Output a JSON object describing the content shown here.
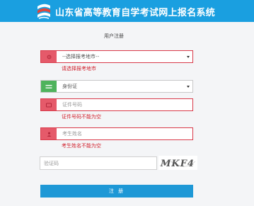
{
  "header": {
    "site_title": "山东省高等教育自学考试网上报名系统"
  },
  "form": {
    "title": "用户注册",
    "region_select": {
      "value": "--选择报考地市--",
      "error": "请选择报考地市"
    },
    "id_type_select": {
      "value": "身份证"
    },
    "id_number": {
      "placeholder": "证件号码",
      "error": "证件号码不能为空"
    },
    "name": {
      "placeholder": "考生姓名",
      "error": "考生姓名不能为空"
    },
    "captcha": {
      "placeholder": "验证码",
      "image_text": "MKF4"
    },
    "submit_label": "注 册"
  },
  "colors": {
    "header_bg": "#1a9fe0",
    "error": "#d11f2b",
    "error_icon_bg": "#e55a6a",
    "ok_icon_bg": "#4fb35c",
    "button_bg": "#1e98d6"
  },
  "icons": {
    "logo": "exam-logo-icon",
    "region": "location-icon",
    "id_type": "id-card-icon",
    "id_number": "id-number-icon",
    "name": "user-icon"
  }
}
